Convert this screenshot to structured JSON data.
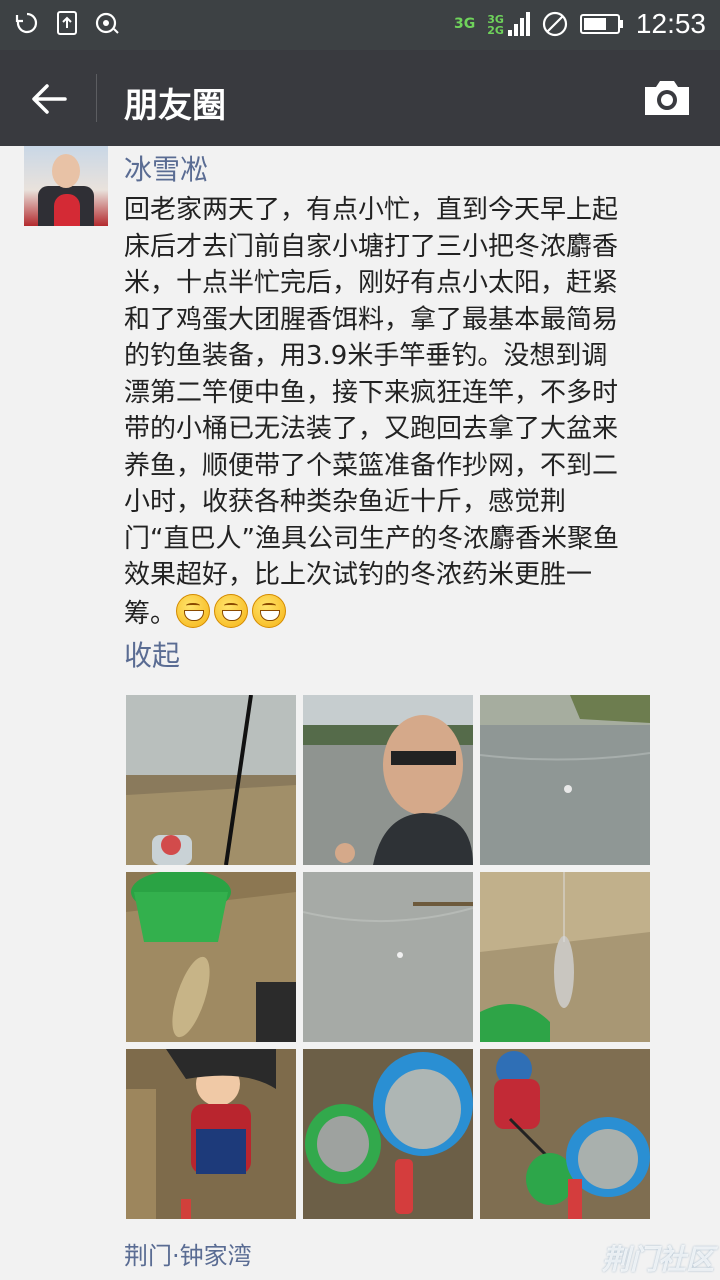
{
  "status_bar": {
    "time": "12:53",
    "network_primary": "3G",
    "network_secondary_top": "3G",
    "network_secondary_bottom": "2G",
    "icons": [
      "sync-icon",
      "upload-icon",
      "voicemail-icon",
      "signal-icon",
      "no-sim-icon",
      "battery-icon"
    ]
  },
  "app_bar": {
    "title": "朋友圈",
    "back_icon": "arrow-left-icon",
    "camera_icon": "camera-icon"
  },
  "post": {
    "username": "冰雪凇",
    "text": "回老家两天了，有点小忙，直到今天早上起\n床后才去门前自家小塘打了三小把冬浓麝香\n米，十点半忙完后，刚好有点小太阳，赶紧\n和了鸡蛋大团腥香饵料，拿了最基本最简易\n的钓鱼装备，用3.9米手竿垂钓。没想到调\n漂第二竿便中鱼，接下来疯狂连竿，不多时\n带的小桶已无法装了，又跑回去拿了大盆来\n养鱼，顺便带了个菜篮准备作抄网，不到二\n小时，收获各种类杂鱼近十斤，感觉荆\n门“直巴人”渔具公司生产的冬浓麝香米聚鱼\n效果超好，比上次试钓的冬浓药米更胜一\n筹。",
    "emoji_count": 3,
    "collapse_label": "收起",
    "location": "荆门·钟家湾",
    "photos": [
      "photo-fishing-rod-reeds",
      "photo-selfie-pond",
      "photo-pond-water",
      "photo-green-bucket-fish",
      "photo-pond-float",
      "photo-fish-on-line",
      "photo-child-with-fish",
      "photo-basin-of-fish",
      "photo-child-and-basins"
    ]
  },
  "watermark": "荆门社区",
  "colors": {
    "status_bar": "#3d4144",
    "app_bar": "#393a3f",
    "link": "#5a6c93",
    "background": "#f2f2f2"
  }
}
